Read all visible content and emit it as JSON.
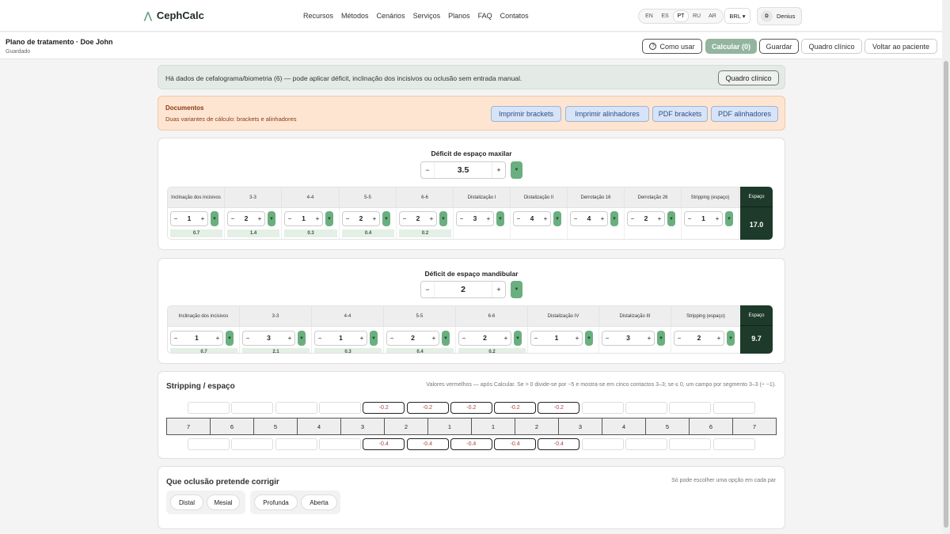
{
  "app": {
    "name": "CephCalc"
  },
  "nav": [
    "Recursos",
    "Métodos",
    "Cenários",
    "Serviços",
    "Planos",
    "FAQ",
    "Contatos"
  ],
  "languages": [
    "EN",
    "ES",
    "PT",
    "RU",
    "AR"
  ],
  "active_language": "PT",
  "currency": "BRL ▾",
  "user": {
    "initial": "D",
    "name": "Denius"
  },
  "plan": {
    "title": "Plano de tratamento · Doe John",
    "status": "Guardado"
  },
  "actions": {
    "help": "Como usar",
    "calc": "Calcular  (0)",
    "save": "Guardar",
    "clinical": "Quadro clínico",
    "back": "Voltar ao paciente"
  },
  "info": {
    "text": "Há dados de cefalograma/biometria (6) — pode aplicar déficit, inclinação dos incisivos ou oclusão sem entrada manual.",
    "button": "Quadro clínico"
  },
  "documents": {
    "title": "Documentos",
    "subtitle": "Duas variantes de cálculo: brackets e alinhadores",
    "buttons": [
      "Imprimir brackets",
      "Imprimir alinhadores",
      "PDF brackets",
      "PDF alinhadores"
    ]
  },
  "maxillary": {
    "title": "Déficit de espaço maxilar",
    "deficit": "3.5",
    "columns": [
      {
        "label": "Inclinação dos incisivos",
        "value": "1",
        "result": "0.7"
      },
      {
        "label": "3-3",
        "value": "2",
        "result": "1.4"
      },
      {
        "label": "4-4",
        "value": "1",
        "result": "0.3"
      },
      {
        "label": "5-5",
        "value": "2",
        "result": "0.4"
      },
      {
        "label": "6-6",
        "value": "2",
        "result": "0.2"
      },
      {
        "label": "Distalização I",
        "value": "3",
        "result": ""
      },
      {
        "label": "Distalização II",
        "value": "4",
        "result": ""
      },
      {
        "label": "Derrotação 16",
        "value": "4",
        "result": ""
      },
      {
        "label": "Derrotação 26",
        "value": "2",
        "result": ""
      },
      {
        "label": "Stripping (espaço)",
        "value": "1",
        "result": ""
      }
    ],
    "total_label": "Espaço",
    "total": "17.0"
  },
  "mandibular": {
    "title": "Déficit de espaço mandibular",
    "deficit": "2",
    "columns": [
      {
        "label": "Inclinação dos incisivos",
        "value": "1",
        "result": "0.7"
      },
      {
        "label": "3-3",
        "value": "3",
        "result": "2.1"
      },
      {
        "label": "4-4",
        "value": "1",
        "result": "0.3"
      },
      {
        "label": "5-5",
        "value": "2",
        "result": "0.4"
      },
      {
        "label": "6-6",
        "value": "2",
        "result": "0.2"
      },
      {
        "label": "Distalização IV",
        "value": "1",
        "result": ""
      },
      {
        "label": "Distalização III",
        "value": "3",
        "result": ""
      },
      {
        "label": "Stripping (espaço)",
        "value": "2",
        "result": ""
      }
    ],
    "total_label": "Espaço",
    "total": "9.7"
  },
  "stripping": {
    "title": "Stripping / espaço",
    "note": "Valores vermelhos — após Calcular. Se > 0 divide-se por −5 e mostra-se em cinco contactos 3–3; se ≤ 0, um campo por segmento 3–3 (÷ −1).",
    "upper": [
      "",
      "",
      "",
      "",
      "-0.2",
      "-0.2",
      "-0.2",
      "-0.2",
      "-0.2",
      "",
      "",
      "",
      ""
    ],
    "teeth": [
      "7",
      "6",
      "5",
      "4",
      "3",
      "2",
      "1",
      "1",
      "2",
      "3",
      "4",
      "5",
      "6",
      "7"
    ],
    "lower": [
      "",
      "",
      "",
      "",
      "-0.4",
      "-0.4",
      "-0.4",
      "-0.4",
      "-0.4",
      "",
      "",
      "",
      ""
    ]
  },
  "occlusion": {
    "title": "Que oclusão pretende corrigir",
    "note": "Só pode escolher uma opção em cada par",
    "groups": [
      [
        "Distal",
        "Mesial"
      ],
      [
        "Profunda",
        "Aberta"
      ]
    ]
  }
}
